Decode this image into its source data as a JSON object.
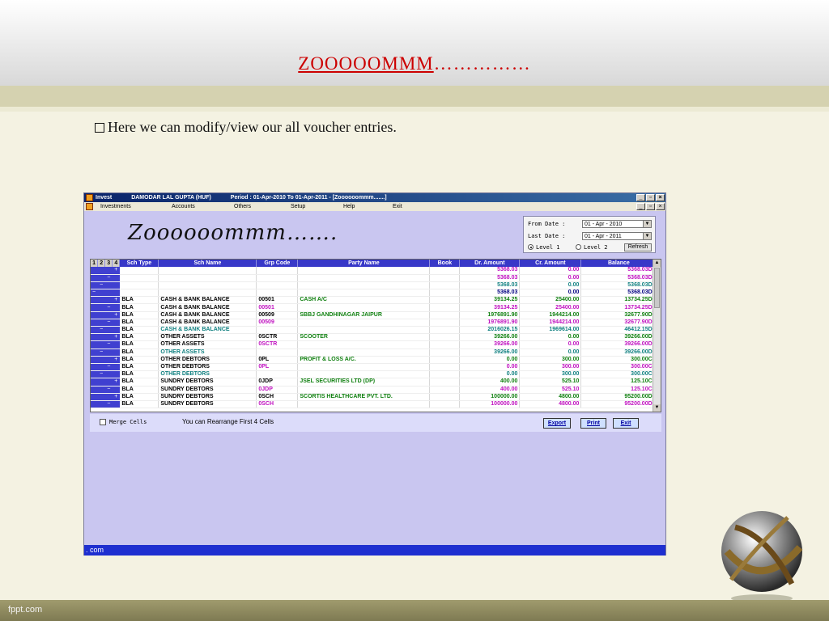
{
  "slide": {
    "title_underlined": "ZOOOOOMMM",
    "title_dots": "……………",
    "bullet": "Here we can modify/view our all voucher entries.",
    "footer": "fppt.com"
  },
  "app": {
    "titlebar": {
      "app": "Invest",
      "company": "DAMODAR LAL GUPTA (HUF)",
      "period": "Period : 01-Apr-2010  To  01-Apr-2011 - [Zoooooommm.......]"
    },
    "menu": [
      "Investments",
      "Accounts",
      "Others",
      "Setup",
      "Help",
      "Exit"
    ],
    "heading": "Zoooooommm…….",
    "filter": {
      "from_label": "From Date  :",
      "from_value": "01 - Apr - 2010",
      "last_label": "Last Date  :",
      "last_value": "01 - Apr - 2011",
      "level1": "Level 1",
      "level2": "Level 2",
      "refresh": "Refresh"
    },
    "grid": {
      "levels": [
        "1",
        "2",
        "3",
        "4"
      ],
      "columns": [
        "Sch Type",
        "Sch Name",
        "Grp Code",
        "Party Name",
        "Book",
        "Dr. Amount",
        "Cr. Amount",
        "Balance"
      ],
      "rows": [
        {
          "tree": "+",
          "indent": 3,
          "sch_type": "",
          "sch_name": "",
          "grp": "",
          "party": "",
          "book": "",
          "dr": "5368.03",
          "cr": "0.00",
          "bal": "5368.03Dr",
          "style": "mag"
        },
        {
          "tree": "−",
          "indent": 2,
          "sch_type": "",
          "sch_name": "",
          "grp": "",
          "party": "",
          "book": "",
          "dr": "5368.03",
          "cr": "0.00",
          "bal": "5368.03Dr",
          "style": "mag"
        },
        {
          "tree": "−",
          "indent": 1,
          "sch_type": "",
          "sch_name": "",
          "grp": "",
          "party": "",
          "book": "",
          "dr": "5368.03",
          "cr": "0.00",
          "bal": "5368.03Dr",
          "style": "teal"
        },
        {
          "tree": "−",
          "indent": 0,
          "sch_type": "",
          "sch_name": "",
          "grp": "",
          "party": "",
          "book": "",
          "dr": "5368.03",
          "cr": "0.00",
          "bal": "5368.03Dr",
          "style": "navy"
        },
        {
          "tree": "+",
          "indent": 3,
          "sch_type": "BLA",
          "sch_name": "CASH & BANK BALANCE",
          "grp": "00501",
          "party": "CASH A/C",
          "book": "",
          "dr": "39134.25",
          "cr": "25400.00",
          "bal": "13734.25Dr",
          "style": "green"
        },
        {
          "tree": "−",
          "indent": 2,
          "sch_type": "BLA",
          "sch_name": "CASH & BANK BALANCE",
          "grp": "00501",
          "party": "",
          "book": "",
          "dr": "39134.25",
          "cr": "25400.00",
          "bal": "13734.25Dr",
          "style": "mag"
        },
        {
          "tree": "+",
          "indent": 3,
          "sch_type": "BLA",
          "sch_name": "CASH & BANK BALANCE",
          "grp": "00509",
          "party": "SBBJ GANDHINAGAR JAIPUR",
          "book": "",
          "dr": "1976891.90",
          "cr": "1944214.00",
          "bal": "32677.90Dr",
          "style": "green"
        },
        {
          "tree": "−",
          "indent": 2,
          "sch_type": "BLA",
          "sch_name": "CASH & BANK BALANCE",
          "grp": "00509",
          "party": "",
          "book": "",
          "dr": "1976891.90",
          "cr": "1944214.00",
          "bal": "32677.90Dr",
          "style": "mag"
        },
        {
          "tree": "−",
          "indent": 1,
          "sch_type": "BLA",
          "sch_name": "CASH & BANK BALANCE",
          "grp": "",
          "party": "",
          "book": "",
          "dr": "2016026.15",
          "cr": "1969614.00",
          "bal": "46412.15Dr",
          "style": "teal"
        },
        {
          "tree": "+",
          "indent": 3,
          "sch_type": "BLA",
          "sch_name": "OTHER ASSETS",
          "grp": "0SCTR",
          "party": "SCOOTER",
          "book": "",
          "dr": "39266.00",
          "cr": "0.00",
          "bal": "39266.00Dr",
          "style": "green"
        },
        {
          "tree": "−",
          "indent": 2,
          "sch_type": "BLA",
          "sch_name": "OTHER ASSETS",
          "grp": "0SCTR",
          "party": "",
          "book": "",
          "dr": "39266.00",
          "cr": "0.00",
          "bal": "39266.00Dr",
          "style": "mag"
        },
        {
          "tree": "−",
          "indent": 1,
          "sch_type": "BLA",
          "sch_name": "OTHER ASSETS",
          "grp": "",
          "party": "",
          "book": "",
          "dr": "39266.00",
          "cr": "0.00",
          "bal": "39266.00Dr",
          "style": "teal"
        },
        {
          "tree": "+",
          "indent": 3,
          "sch_type": "BLA",
          "sch_name": "OTHER DEBTORS",
          "grp": "0PL",
          "party": "PROFIT & LOSS A/C.",
          "book": "",
          "dr": "0.00",
          "cr": "300.00",
          "bal": "300.00Cr",
          "style": "green"
        },
        {
          "tree": "−",
          "indent": 2,
          "sch_type": "BLA",
          "sch_name": "OTHER DEBTORS",
          "grp": "0PL",
          "party": "",
          "book": "",
          "dr": "0.00",
          "cr": "300.00",
          "bal": "300.00Cr",
          "style": "mag"
        },
        {
          "tree": "−",
          "indent": 1,
          "sch_type": "BLA",
          "sch_name": "OTHER DEBTORS",
          "grp": "",
          "party": "",
          "book": "",
          "dr": "0.00",
          "cr": "300.00",
          "bal": "300.00Cr",
          "style": "teal"
        },
        {
          "tree": "+",
          "indent": 3,
          "sch_type": "BLA",
          "sch_name": "SUNDRY DEBTORS",
          "grp": "0JDP",
          "party": "JSEL SECURITIES LTD (DP)",
          "book": "",
          "dr": "400.00",
          "cr": "525.10",
          "bal": "125.10Cr",
          "style": "green"
        },
        {
          "tree": "−",
          "indent": 2,
          "sch_type": "BLA",
          "sch_name": "SUNDRY DEBTORS",
          "grp": "0JDP",
          "party": "",
          "book": "",
          "dr": "400.00",
          "cr": "525.10",
          "bal": "125.10Cr",
          "style": "mag"
        },
        {
          "tree": "+",
          "indent": 3,
          "sch_type": "BLA",
          "sch_name": "SUNDRY DEBTORS",
          "grp": "0SCH",
          "party": "SCORTIS HEALTHCARE PVT. LTD.",
          "book": "",
          "dr": "100000.00",
          "cr": "4800.00",
          "bal": "95200.00Dr",
          "style": "green"
        },
        {
          "tree": "−",
          "indent": 2,
          "sch_type": "BLA",
          "sch_name": "SUNDRY DEBTORS",
          "grp": "0SCH",
          "party": "",
          "book": "",
          "dr": "100000.00",
          "cr": "4800.00",
          "bal": "95200.00Dr",
          "style": "mag"
        }
      ]
    },
    "merge_label": "Merge Cells",
    "rearrange_note": "You can Rearrange First 4 Cells",
    "buttons": {
      "export": "Export",
      "print": "Print",
      "exit": "Exit"
    },
    "status": ". com"
  },
  "colors": {
    "title_red": "#cc0000",
    "grid_header": "#3838c8",
    "app_bg": "#c9c6f0",
    "status_blue": "#1e2fd0"
  }
}
